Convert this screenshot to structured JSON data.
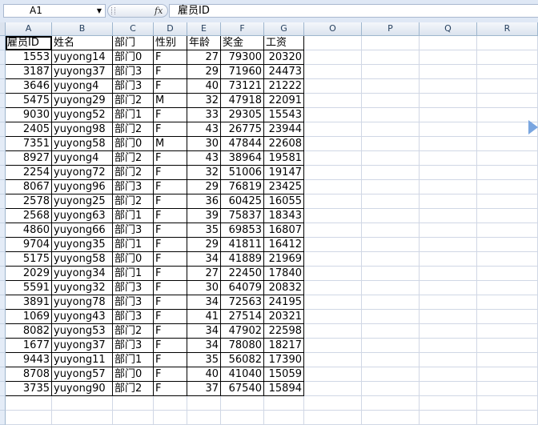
{
  "formula_bar": {
    "name_box": "A1",
    "fx_label": "fx",
    "formula": "雇员ID"
  },
  "columns": [
    "A",
    "B",
    "C",
    "D",
    "E",
    "F",
    "G",
    "O",
    "P",
    "Q",
    "R"
  ],
  "header_row": [
    "雇员ID",
    "姓名",
    "部门",
    "性别",
    "年龄",
    "奖金",
    "工资"
  ],
  "rows": [
    [
      "1553",
      "yuyong14",
      "部门0",
      "F",
      "27",
      "79300",
      "20320"
    ],
    [
      "3187",
      "yuyong37",
      "部门3",
      "F",
      "29",
      "71960",
      "24473"
    ],
    [
      "3646",
      "yuyong4",
      "部门3",
      "F",
      "40",
      "73121",
      "21222"
    ],
    [
      "5475",
      "yuyong29",
      "部门2",
      "M",
      "32",
      "47918",
      "22091"
    ],
    [
      "9030",
      "yuyong52",
      "部门1",
      "F",
      "33",
      "29305",
      "15543"
    ],
    [
      "2405",
      "yuyong98",
      "部门2",
      "F",
      "43",
      "26775",
      "23944"
    ],
    [
      "7351",
      "yuyong58",
      "部门0",
      "M",
      "30",
      "47844",
      "22608"
    ],
    [
      "8927",
      "yuyong4",
      "部门2",
      "F",
      "43",
      "38964",
      "19581"
    ],
    [
      "2254",
      "yuyong72",
      "部门2",
      "F",
      "32",
      "51006",
      "19147"
    ],
    [
      "8067",
      "yuyong96",
      "部门3",
      "F",
      "29",
      "76819",
      "23425"
    ],
    [
      "2578",
      "yuyong25",
      "部门2",
      "F",
      "36",
      "60425",
      "16055"
    ],
    [
      "2568",
      "yuyong63",
      "部门1",
      "F",
      "39",
      "75837",
      "18343"
    ],
    [
      "4860",
      "yuyong66",
      "部门3",
      "F",
      "35",
      "69853",
      "16807"
    ],
    [
      "9704",
      "yuyong35",
      "部门1",
      "F",
      "29",
      "41811",
      "16412"
    ],
    [
      "5175",
      "yuyong58",
      "部门0",
      "F",
      "34",
      "41889",
      "21969"
    ],
    [
      "2029",
      "yuyong34",
      "部门1",
      "F",
      "27",
      "22450",
      "17840"
    ],
    [
      "5591",
      "yuyong32",
      "部门3",
      "F",
      "30",
      "64079",
      "20832"
    ],
    [
      "3891",
      "yuyong78",
      "部门3",
      "F",
      "34",
      "72563",
      "24195"
    ],
    [
      "1069",
      "yuyong43",
      "部门3",
      "F",
      "41",
      "27514",
      "20321"
    ],
    [
      "8082",
      "yuyong53",
      "部门2",
      "F",
      "34",
      "47902",
      "22598"
    ],
    [
      "1677",
      "yuyong37",
      "部门3",
      "F",
      "34",
      "78080",
      "18217"
    ],
    [
      "9443",
      "yuyong11",
      "部门1",
      "F",
      "35",
      "56082",
      "17390"
    ],
    [
      "8708",
      "yuyong57",
      "部门0",
      "F",
      "40",
      "41040",
      "15059"
    ],
    [
      "3735",
      "yuyong90",
      "部门2",
      "F",
      "37",
      "67540",
      "15894"
    ]
  ]
}
